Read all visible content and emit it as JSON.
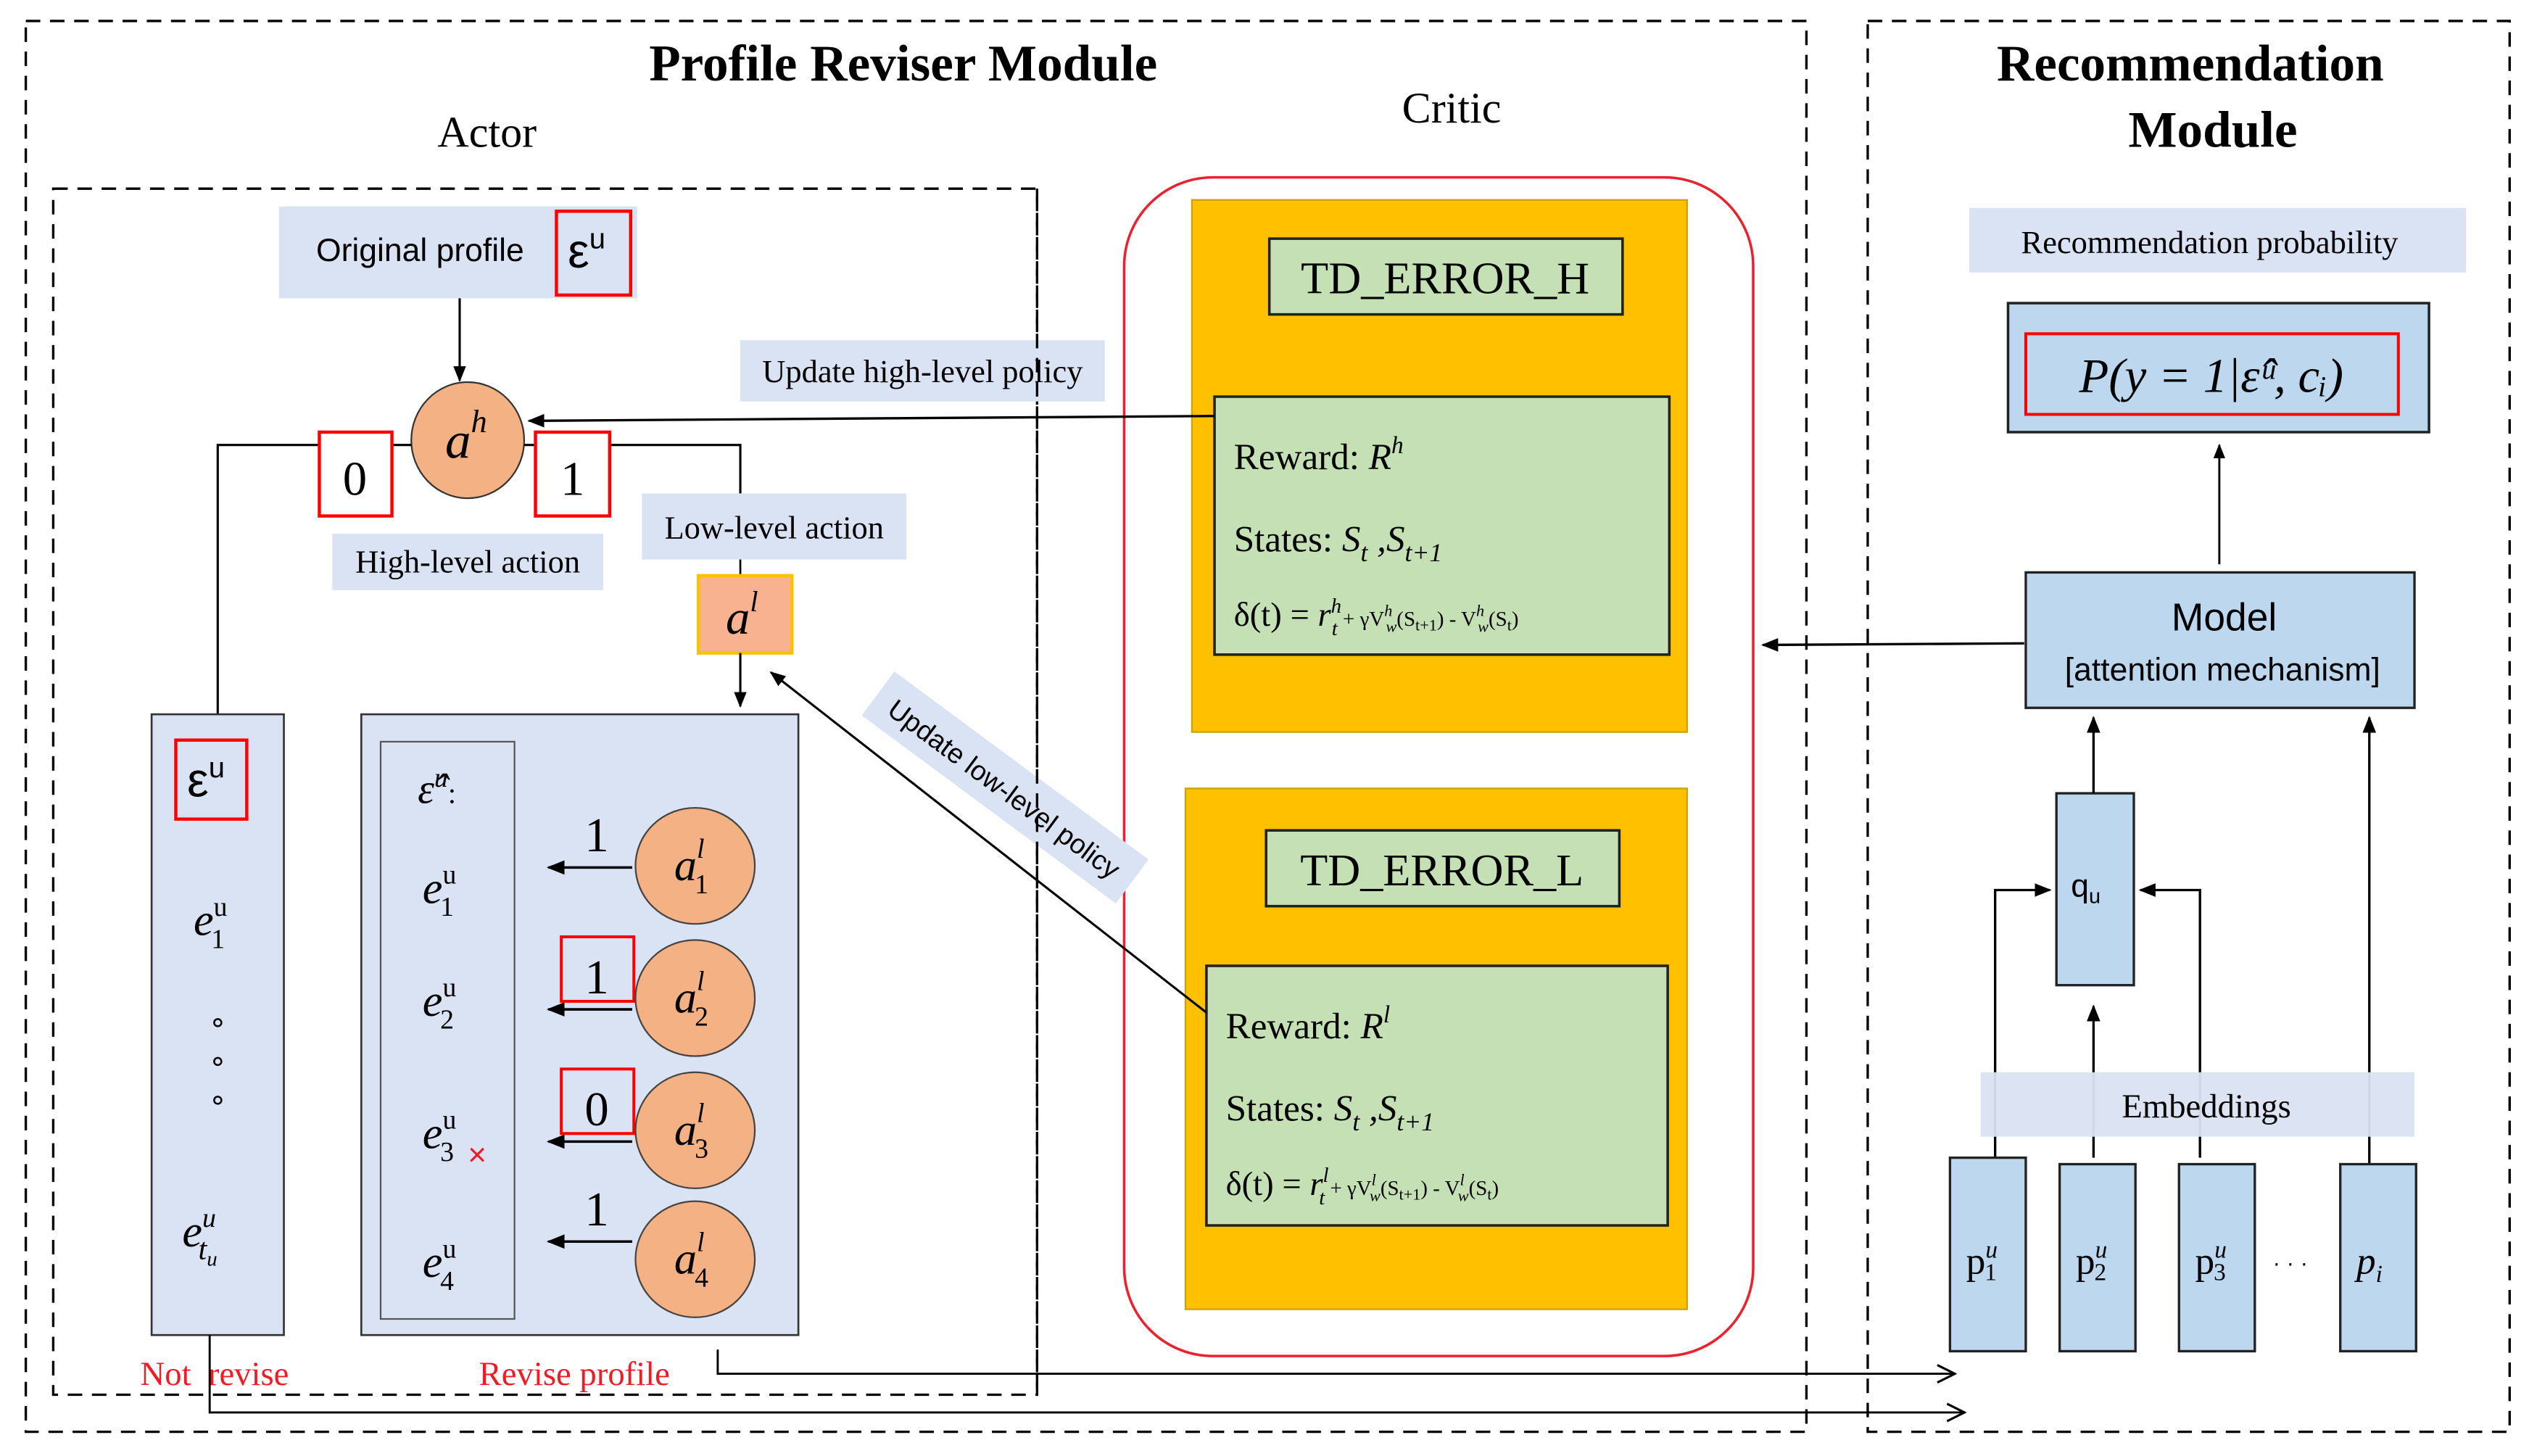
{
  "profile_reviser_module": {
    "title": "Profile Reviser Module",
    "actor": {
      "title": "Actor",
      "original_profile_label": "Original profile",
      "original_profile_symbol": "ε",
      "original_profile_sup": "u",
      "high_level_action_node": "a",
      "high_level_action_node_sup": "h",
      "high_level_options": [
        "0",
        "1"
      ],
      "high_level_action_label": "High-level action",
      "low_level_action_label": "Low-level action",
      "low_level_action_node": "a",
      "low_level_action_node_sup": "l",
      "not_revise_column": {
        "header_symbol": "ε",
        "header_sup": "u",
        "items": [
          {
            "base": "e",
            "sup": "u",
            "sub": "1"
          },
          {
            "base": "e",
            "sup": "u",
            "sub": "t",
            "subsub": "u"
          }
        ],
        "ellipsis": "∘"
      },
      "revise_column": {
        "header_symbol": "ε̂",
        "header_sup": "u",
        "header_suffix": ":",
        "items": [
          {
            "base": "e",
            "sup": "u",
            "sub": "1",
            "decision": "1",
            "highlighted": false,
            "removed": false,
            "action": "a",
            "action_sup": "l",
            "action_sub": "1"
          },
          {
            "base": "e",
            "sup": "u",
            "sub": "2",
            "decision": "1",
            "highlighted": true,
            "removed": false,
            "action": "a",
            "action_sup": "l",
            "action_sub": "2"
          },
          {
            "base": "e",
            "sup": "u",
            "sub": "3",
            "decision": "0",
            "highlighted": true,
            "removed": true,
            "action": "a",
            "action_sup": "l",
            "action_sub": "3"
          },
          {
            "base": "e",
            "sup": "u",
            "sub": "4",
            "decision": "1",
            "highlighted": false,
            "removed": false,
            "action": "a",
            "action_sup": "l",
            "action_sub": "4"
          }
        ],
        "removed_mark": "×"
      },
      "not_revise_label": "Not  revise",
      "revise_profile_label": "Revise profile"
    },
    "arrows": {
      "update_high_level": "Update high-level policy",
      "update_low_level": "Update low-level policy"
    },
    "critic": {
      "title": "Critic",
      "blocks": [
        {
          "name": "TD_ERROR_H",
          "reward_label": "Reward: ",
          "reward_symbol": "R",
          "reward_sup": "h",
          "states_label": "States: ",
          "states": "S_t , S_{t+1}",
          "delta_lhs": "δ(t) = ",
          "delta_rhs": "r_t^h + γV_w^h(S_{t+1}) - V_w^h(S_t)",
          "level": "h"
        },
        {
          "name": "TD_ERROR_L",
          "reward_label": "Reward: ",
          "reward_symbol": "R",
          "reward_sup": "l",
          "states_label": "States: ",
          "states": "S_t , S_{t+1}",
          "delta_lhs": "δ(t) = ",
          "delta_rhs": "r_t^l + γV_w^l(S_{t+1}) - V_w^l(S_t)",
          "level": "l"
        }
      ]
    }
  },
  "recommendation_module": {
    "title_line1": "Recommendation",
    "title_line2": "Module",
    "probability_label": "Recommendation probability",
    "probability_formula": "P(y = 1|ε̂ᵘ, cᵢ)",
    "model_title": "Model",
    "model_subtitle": "[attention mechanism]",
    "user_query": "q",
    "user_query_sub": "u",
    "embeddings_label": "Embeddings",
    "items": [
      {
        "base": "p",
        "sup": "u",
        "sub": "1"
      },
      {
        "base": "p",
        "sup": "u",
        "sub": "2"
      },
      {
        "base": "p",
        "sup": "u",
        "sub": "3"
      },
      {
        "base": "p",
        "sup": "",
        "sub": "i"
      }
    ],
    "items_ellipsis": "· · ·"
  },
  "colors": {
    "light_blue_box": "#dae3f3",
    "blue_box": "#bdd7ee",
    "orange_node": "#f4b183",
    "critic_yellow": "#ffc000",
    "green_box": "#c5e0b4",
    "red_highlight": "#ff0000",
    "red_text": "#ee1c25",
    "black": "#000000"
  }
}
